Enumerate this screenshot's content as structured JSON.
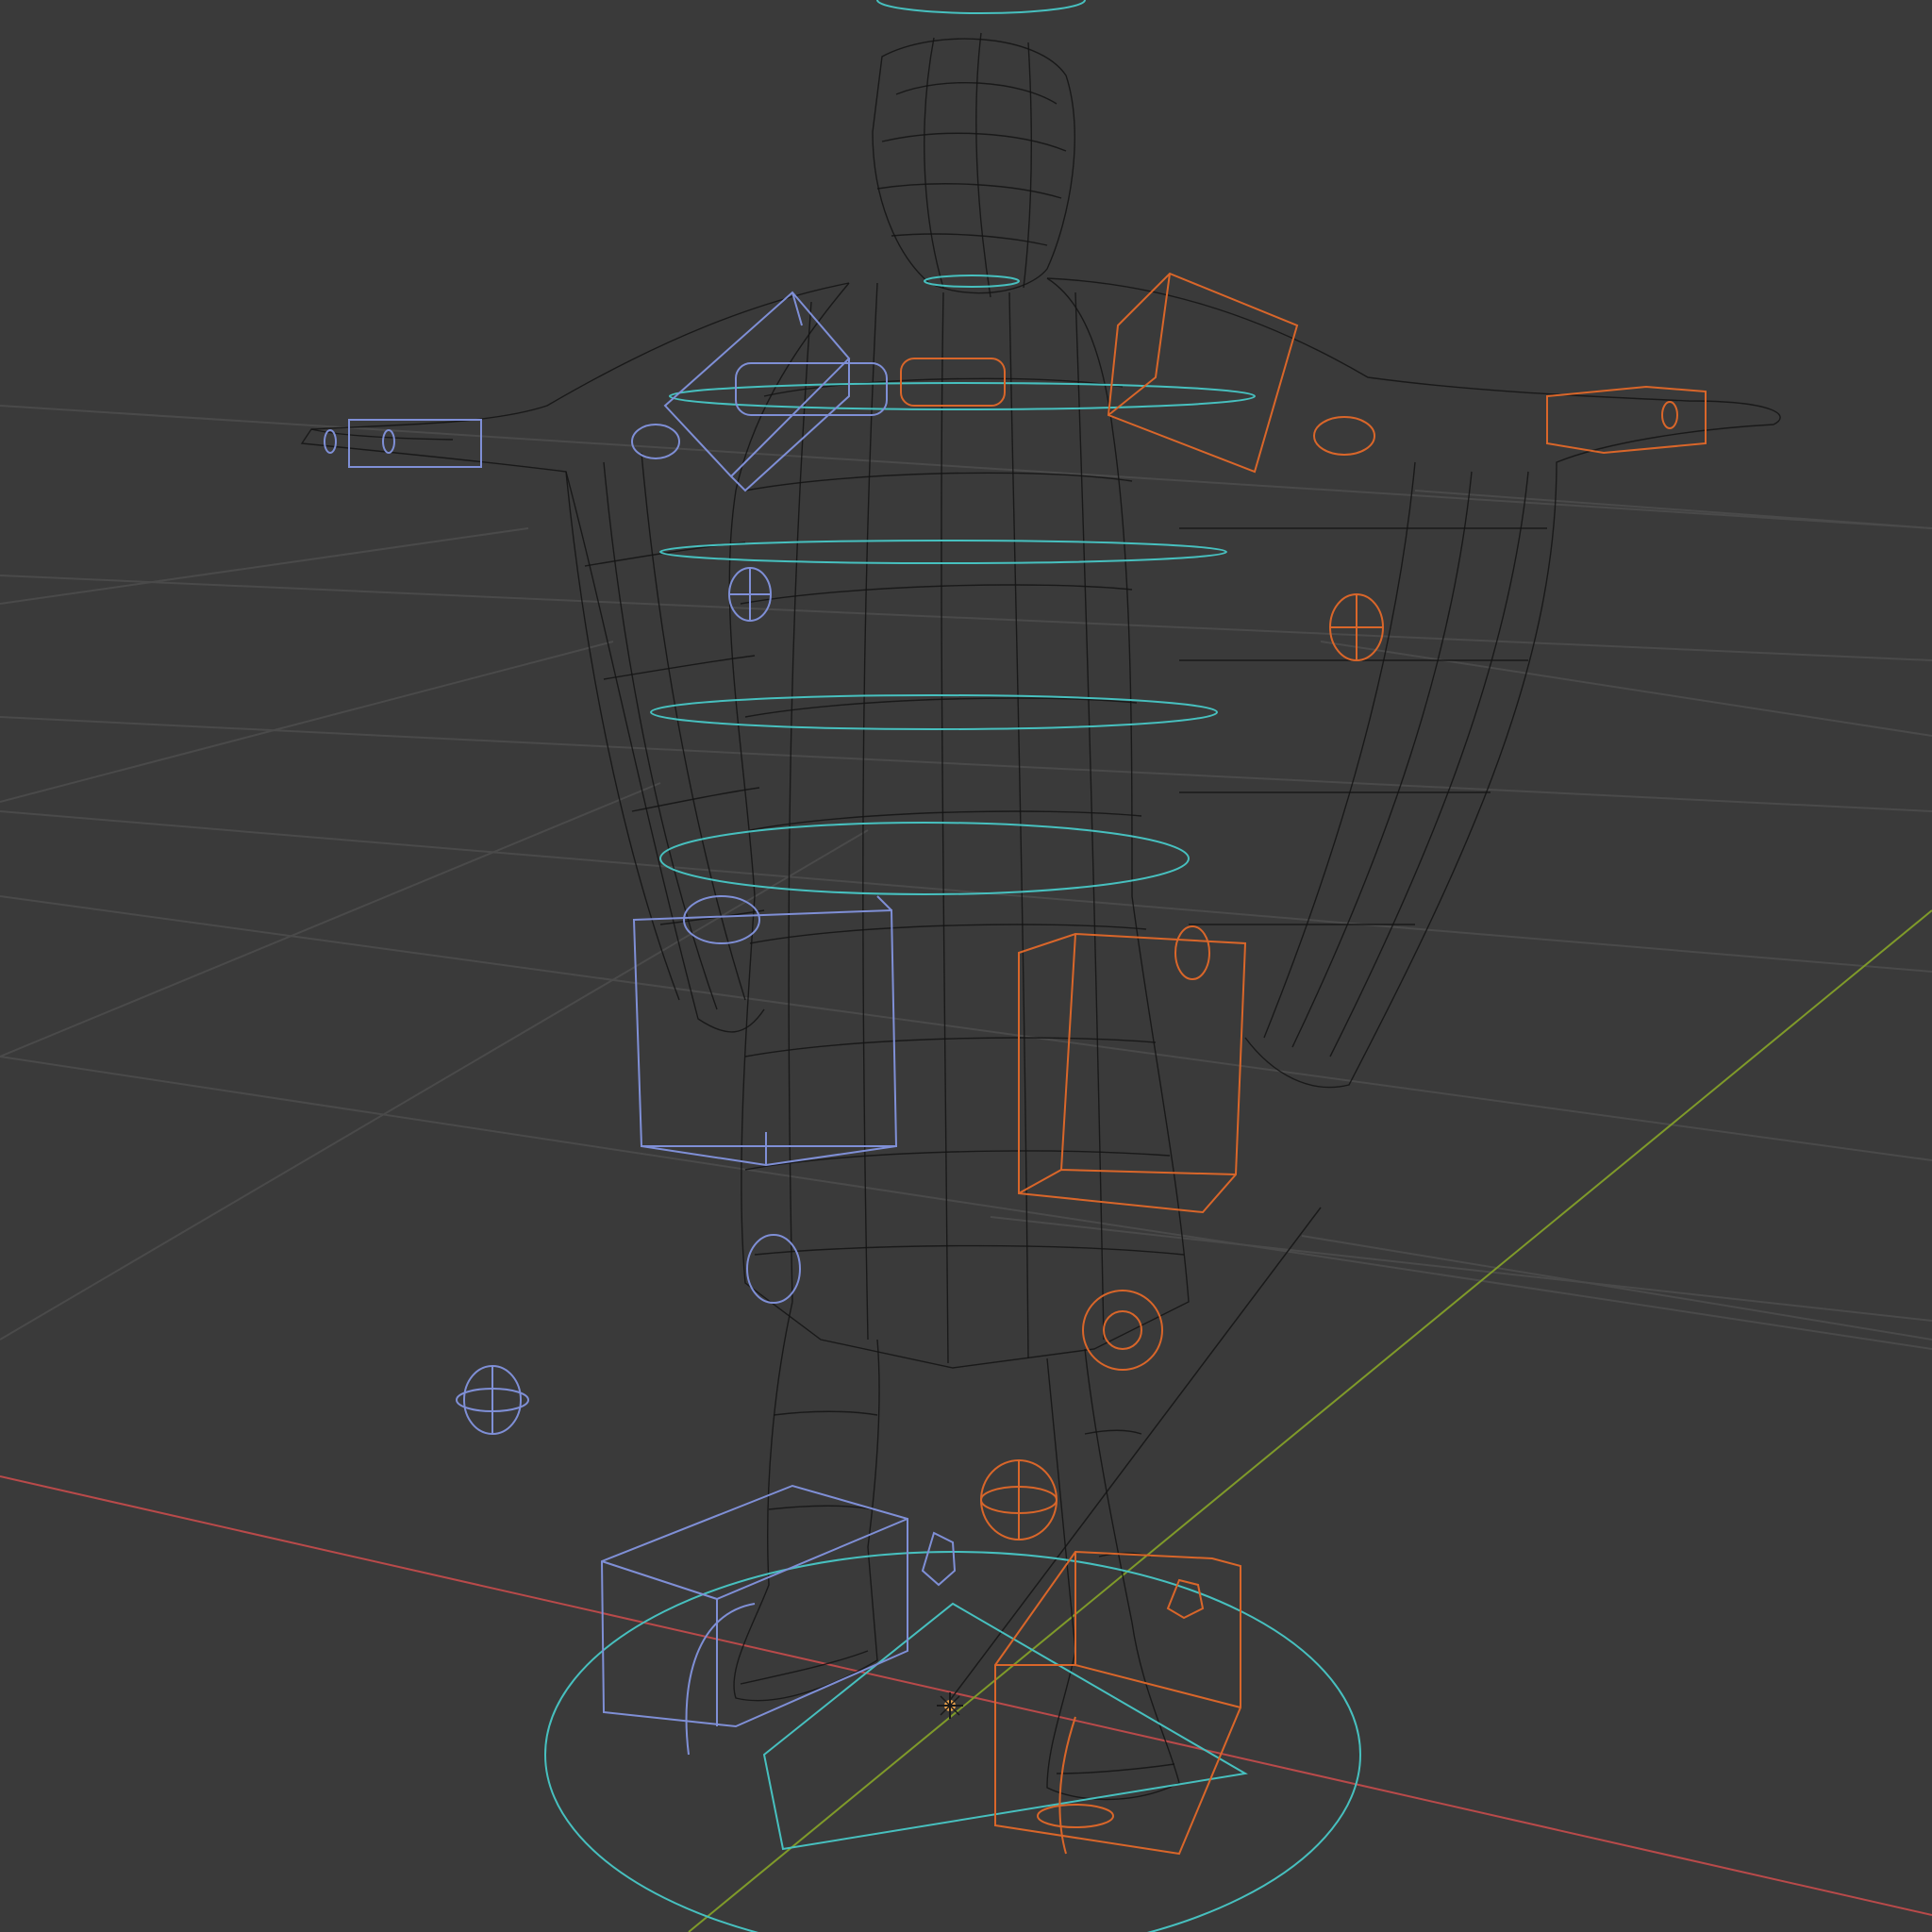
{
  "app": "3D viewport",
  "viewport": {
    "shading_mode": "wireframe",
    "colors": {
      "background": "#3a3a3a",
      "grid": "#4a4a4a",
      "axis_x": "#b94a4a",
      "axis_y": "#7f9a2a",
      "mesh_wire": "#141414",
      "control_left": "#7f8fd6",
      "control_right": "#d9662a",
      "control_center": "#47c0bf",
      "origin_marker": "#e8a04a"
    },
    "objects": {
      "mesh": "robed-figure-mesh",
      "rig": "armature-controls",
      "origin": "world-origin-icon"
    }
  }
}
